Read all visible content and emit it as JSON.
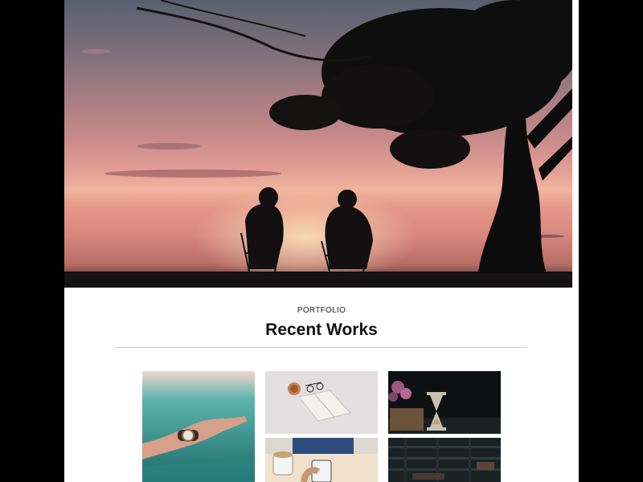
{
  "hero": {
    "image": "silhouette-couple-under-tree-sunset-photo"
  },
  "portfolio": {
    "label": "PORTFOLIO",
    "title": "Recent Works"
  },
  "works": [
    {
      "image": "hand-with-watch-in-water-photo"
    },
    {
      "image": "open-book-glasses-coffee-photo"
    },
    {
      "image": "hourglass-and-flowers-photo"
    },
    {
      "image": "phone-and-mug-on-desk-photo"
    },
    {
      "image": "dark-interior-photo"
    }
  ]
}
